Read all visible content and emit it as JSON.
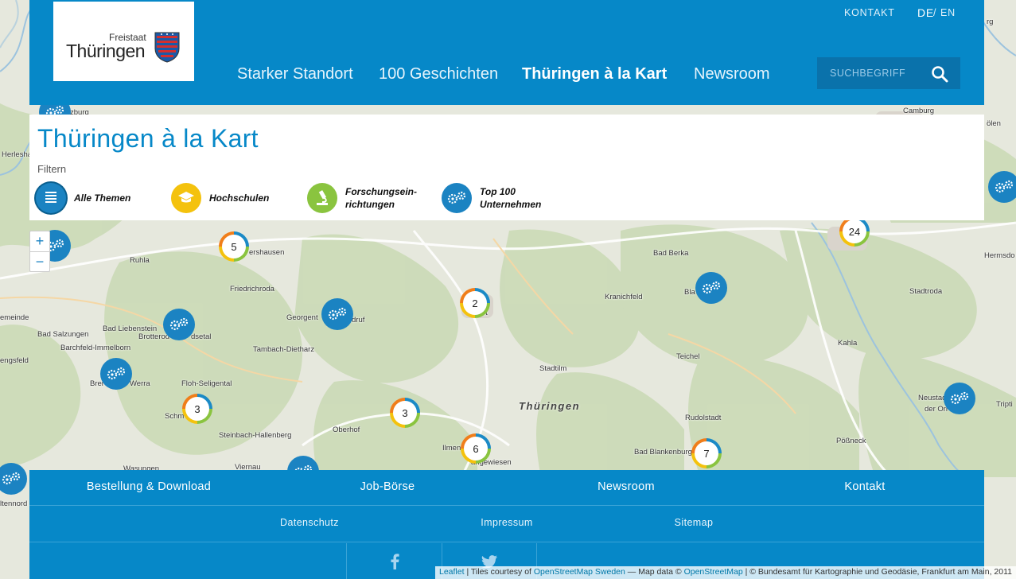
{
  "header": {
    "logo_small": "Freistaat",
    "logo_main": "Thüringen",
    "top_links": {
      "contact": "KONTAKT",
      "lang_de": "DE",
      "lang_sep": "/",
      "lang_en": "EN"
    },
    "nav": [
      "Starker Standort",
      "100 Geschichten",
      "Thüringen à la Kart",
      "Newsroom"
    ],
    "search_placeholder": "SUCHBEGRIFF"
  },
  "panel": {
    "title": "Thüringen à la Kart",
    "filter_label": "Filtern",
    "filters": [
      {
        "label_line1": "Alle Themen",
        "label_line2": "",
        "icon": "list-icon",
        "color": "#1b83c2"
      },
      {
        "label_line1": "Hochschulen",
        "label_line2": "",
        "icon": "graduation-cap-icon",
        "color": "#f4c20d"
      },
      {
        "label_line1": "Forschungsein-",
        "label_line2": "richtungen",
        "icon": "microscope-icon",
        "color": "#8ac43f"
      },
      {
        "label_line1": "Top 100",
        "label_line2": "Unternehmen",
        "icon": "gears-icon",
        "color": "#1b83c2"
      }
    ]
  },
  "map": {
    "zoom_in": "+",
    "zoom_out": "−",
    "region_label": "Thüringen",
    "places": [
      "Herlesha",
      "Camburg",
      "ölen",
      "Ruhla",
      "ershausen",
      "Bad Berka",
      "Hermsdo",
      "Friedrichroda",
      "Kranichfeld",
      "Bla",
      "Stadtroda",
      "emeinde",
      "Georgent",
      "druf",
      "rt",
      "Bad Liebenstein",
      "Brotterod",
      "dsetal",
      "Bad Salzungen",
      "Barchfeld-Immelborn",
      "Tambach-Dietharz",
      "Kahla",
      "engsfeld",
      "Brei",
      "Werra",
      "Floh-Seligental",
      "Teichel",
      "Stadtilm",
      "Schm",
      "Neustad",
      "der Ori",
      "Tripti",
      "Rudolstadt",
      "Steinbach-Hallenberg",
      "Oberhof",
      "Ilmen",
      "angewiesen",
      "Pößneck",
      "Bad Blankenburg",
      "Wasungen",
      "Viernau",
      "ltennord",
      "rg",
      "zburg"
    ],
    "clusters": [
      {
        "count": "5"
      },
      {
        "count": "2"
      },
      {
        "count": "24"
      },
      {
        "count": "3"
      },
      {
        "count": "3"
      },
      {
        "count": "6"
      },
      {
        "count": "7"
      }
    ],
    "gear_markers": 11
  },
  "footer": {
    "row1": [
      "Bestellung & Download",
      "Job-Börse",
      "Newsroom",
      "Kontakt"
    ],
    "row2": [
      "Datenschutz",
      "Impressum",
      "Sitemap"
    ],
    "social": [
      "facebook-icon",
      "twitter-icon"
    ]
  },
  "attribution": {
    "leaflet": "Leaflet",
    "sep1": " | Tiles courtesy of ",
    "osm_sweden": "OpenStreetMap Sweden",
    "sep2": " — Map data © ",
    "osm": "OpenStreetMap",
    "rest": " | © Bundesamt für Kartographie und Geodäsie, Frankfurt am Main, 2011"
  },
  "colors": {
    "brand_blue": "#0688c8",
    "dark_blue": "#0a72ab",
    "yellow": "#f4c20d",
    "green": "#8ac43f",
    "orange": "#f07e1b"
  }
}
